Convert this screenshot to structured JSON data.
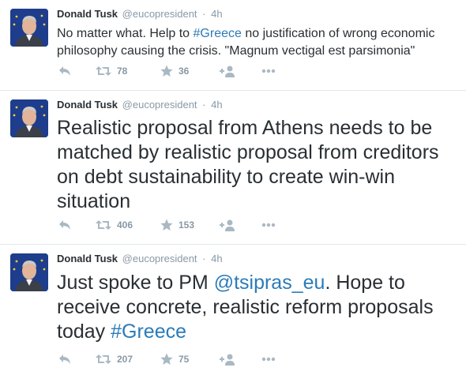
{
  "tweets": [
    {
      "name": "Donald Tusk",
      "handle": "@eucopresident",
      "separator": "·",
      "time": "4h",
      "text_parts": [
        "No matter what. Help to ",
        "#Greece",
        " no justification of wrong economic philosophy causing the crisis. \"Magnum vectigal est parsimonia\""
      ],
      "retweets": "78",
      "favorites": "36"
    },
    {
      "name": "Donald Tusk",
      "handle": "@eucopresident",
      "separator": "·",
      "time": "4h",
      "text_parts": [
        "Realistic proposal from Athens needs to be matched by realistic proposal from creditors on debt sustainability to create win-win situation"
      ],
      "retweets": "406",
      "favorites": "153"
    },
    {
      "name": "Donald Tusk",
      "handle": "@eucopresident",
      "separator": "·",
      "time": "4h",
      "text_parts": [
        "Just spoke to PM ",
        "@tsipras_eu",
        ". Hope to receive concrete, realistic reform proposals today ",
        "#Greece"
      ],
      "retweets": "207",
      "favorites": "75"
    }
  ],
  "icons": {
    "reply": "reply-icon",
    "retweet": "retweet-icon",
    "favorite": "star-icon",
    "follow": "follow-icon",
    "more": "more-icon"
  },
  "colors": {
    "link": "#2b7bb9",
    "muted": "#8899a6",
    "text": "#292f33",
    "divider": "#e1e8ed"
  }
}
